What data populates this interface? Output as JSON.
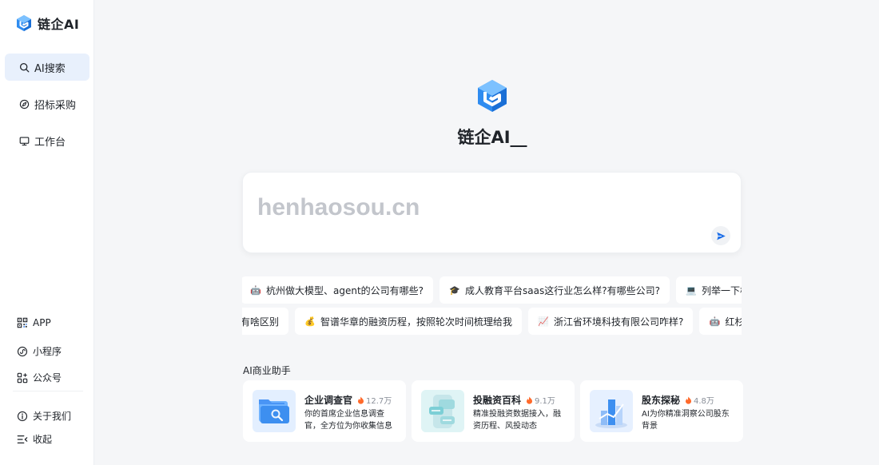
{
  "brand": {
    "name": "链企AI"
  },
  "nav": {
    "items": [
      {
        "label": "AI搜索",
        "icon": "search-icon",
        "active": true
      },
      {
        "label": "招标采购",
        "icon": "compass-icon",
        "active": false
      },
      {
        "label": "工作台",
        "icon": "monitor-icon",
        "active": false
      }
    ]
  },
  "bottom_nav": {
    "app": "APP",
    "miniprogram": "小程序",
    "official_account": "公众号",
    "about": "关于我们",
    "collapse": "收起"
  },
  "main": {
    "title": "链企AI__",
    "search_placeholder": "henhaosou.cn"
  },
  "suggestions": {
    "row1": [
      {
        "emoji": "🤖",
        "text": "杭州做大模型、agent的公司有哪些?"
      },
      {
        "emoji": "🎓",
        "text": "成人教育平台saas这行业怎么样?有哪些公司?"
      },
      {
        "emoji": "💻",
        "text": "列举一下杭州的互联网公司"
      }
    ],
    "row2": [
      {
        "emoji": "",
        "text": "有啥区别"
      },
      {
        "emoji": "💰",
        "text": "智谱华章的融资历程，按照轮次时间梳理给我"
      },
      {
        "emoji": "📈",
        "text": "浙江省环境科技有限公司咋样?"
      },
      {
        "emoji": "🤖",
        "text": "红杉中国投资了哪些公司"
      }
    ]
  },
  "assistants": {
    "section_title": "AI商业助手",
    "cards": [
      {
        "title": "企业调查官",
        "heat": "12.7万",
        "desc": "你的首席企业信息调查官，全方位为你收集信息"
      },
      {
        "title": "投融资百科",
        "heat": "9.1万",
        "desc": "精准投融资数据接入，融资历程、风投动态"
      },
      {
        "title": "股东探秘",
        "heat": "4.8万",
        "desc": "AI为你精准洞察公司股东背景"
      }
    ]
  },
  "colors": {
    "accent": "#1e6fe8",
    "active_bg": "#e8f0fc",
    "heat": "#ff6a2b"
  }
}
